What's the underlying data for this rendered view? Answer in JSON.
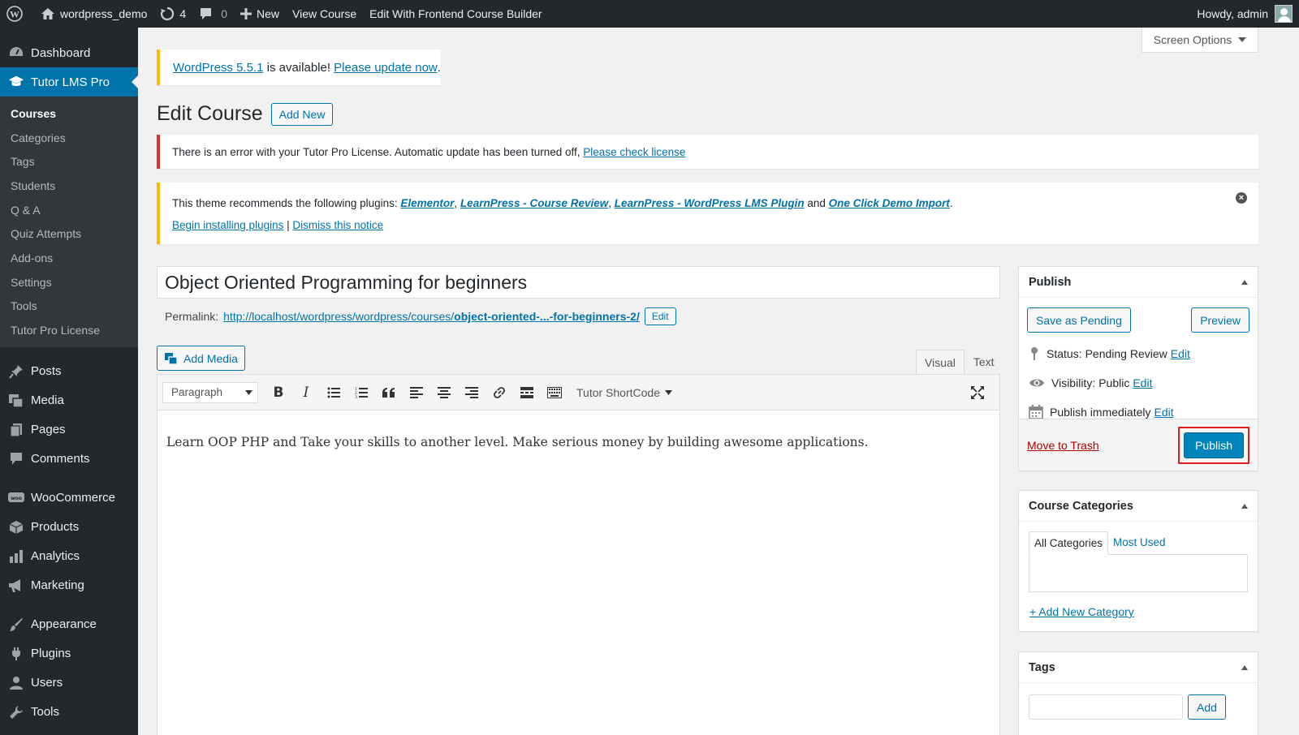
{
  "admin_bar": {
    "site_name": "wordpress_demo",
    "updates_count": "4",
    "comments_count": "0",
    "new_label": "New",
    "view_course": "View Course",
    "frontend_builder": "Edit With Frontend Course Builder",
    "howdy": "Howdy, admin"
  },
  "sidebar": {
    "dashboard": "Dashboard",
    "tutor": "Tutor LMS Pro",
    "submenu": [
      "Courses",
      "Categories",
      "Tags",
      "Students",
      "Q & A",
      "Quiz Attempts",
      "Add-ons",
      "Settings",
      "Tools",
      "Tutor Pro License"
    ],
    "group1": [
      "Posts",
      "Media",
      "Pages",
      "Comments"
    ],
    "group2": [
      "WooCommerce",
      "Products",
      "Analytics",
      "Marketing"
    ],
    "group3": [
      "Appearance",
      "Plugins",
      "Users",
      "Tools"
    ]
  },
  "screen_options": "Screen Options",
  "update_notice": {
    "version_link": "WordPress 5.5.1",
    "is_available": " is available! ",
    "update_link": "Please update now",
    "period": "."
  },
  "page": {
    "title": "Edit Course",
    "add_new": "Add New"
  },
  "license_notice": {
    "text": "There is an error with your Tutor Pro License. Automatic update has been turned off, ",
    "link": "Please check license"
  },
  "plugin_notice": {
    "text": "This theme recommends the following plugins: ",
    "plugins": [
      "Elementor",
      "LearnPress - Course Review",
      "LearnPress - WordPress LMS Plugin",
      "One Click Demo Import"
    ],
    "sep": ", ",
    "and": " and ",
    "period": ".",
    "begin": "Begin installing plugins",
    "pipe": " | ",
    "dismiss": "Dismiss this notice"
  },
  "post": {
    "title": "Object Oriented Programming for beginners",
    "permalink_label": "Permalink:",
    "permalink_base": "http://localhost/wordpress/wordpress/courses/",
    "permalink_slug": "object-oriented-...-for-beginners-2/",
    "edit": "Edit",
    "content": "Learn OOP PHP and Take your skills to another level. Make serious money by building awesome applications."
  },
  "editor": {
    "add_media": "Add Media",
    "tab_visual": "Visual",
    "tab_text": "Text",
    "format": "Paragraph",
    "shortcode": "Tutor ShortCode"
  },
  "publish_box": {
    "title": "Publish",
    "save_pending": "Save as Pending",
    "preview": "Preview",
    "status_label": "Status:",
    "status_value": "Pending Review",
    "visibility_label": "Visibility:",
    "visibility_value": "Public",
    "schedule": "Publish immediately",
    "edit": "Edit",
    "trash": "Move to Trash",
    "publish": "Publish"
  },
  "categories_box": {
    "title": "Course Categories",
    "tab_all": "All Categories",
    "tab_most": "Most Used",
    "add_new": "+ Add New Category"
  },
  "tags_box": {
    "title": "Tags",
    "add": "Add"
  },
  "colors": {
    "admin_dark": "#23282d",
    "accent": "#0073aa",
    "error": "#dc3232",
    "warning": "#ffb900",
    "highlight": "#e21b1b"
  }
}
